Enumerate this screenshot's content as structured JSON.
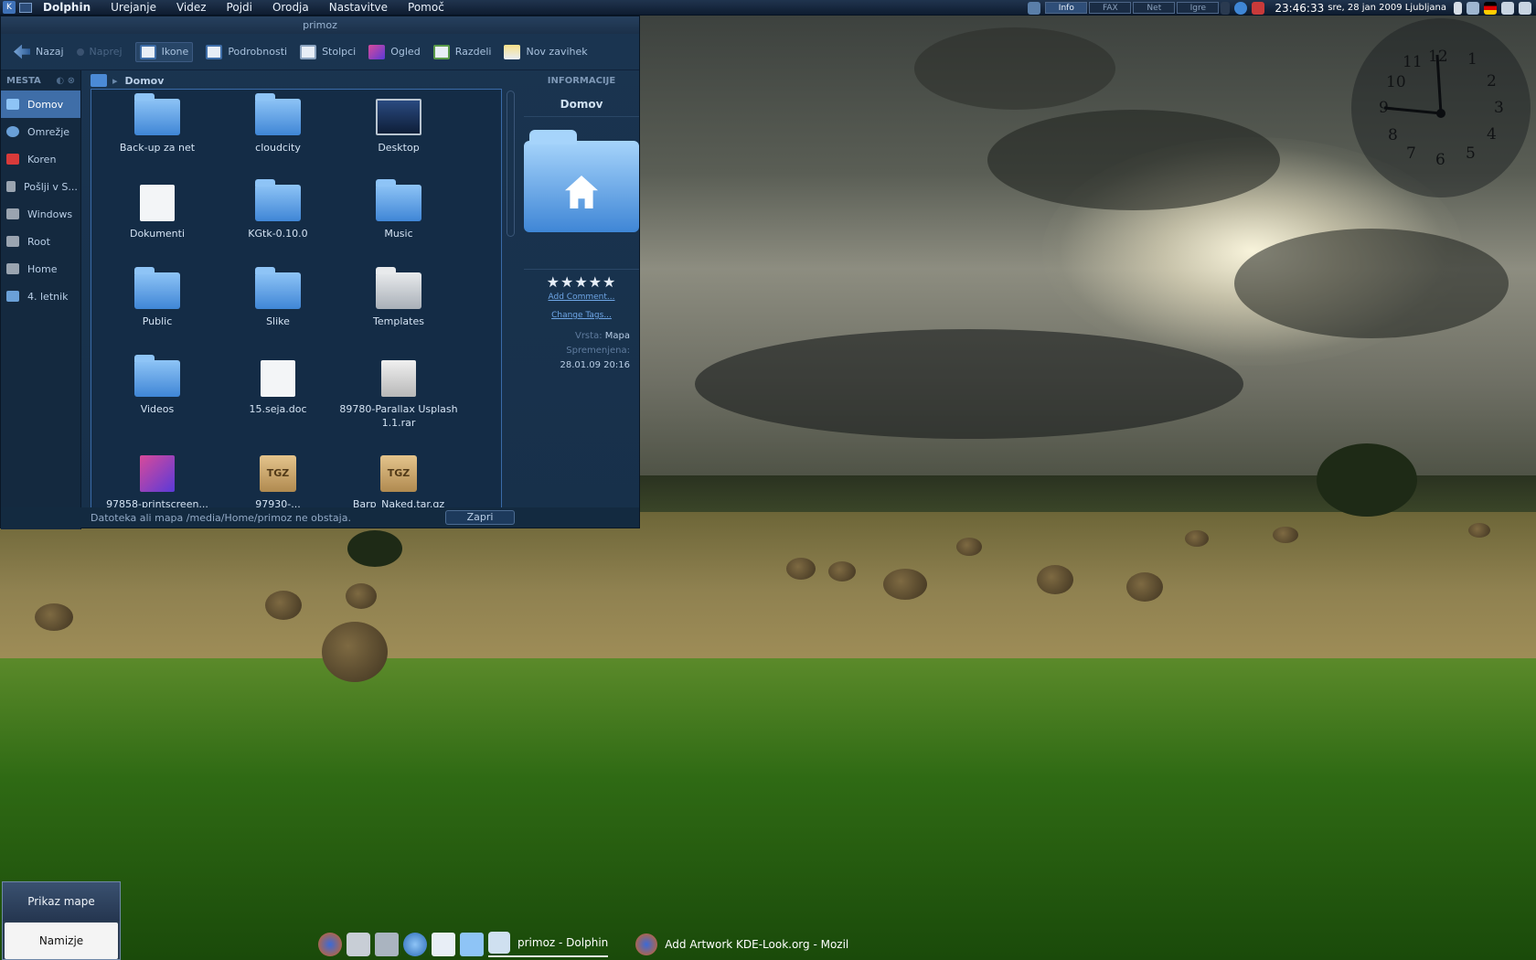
{
  "menubar": {
    "app": "Dolphin",
    "items": [
      "Urejanje",
      "Videz",
      "Pojdi",
      "Orodja",
      "Nastavitve",
      "Pomoč"
    ]
  },
  "tray": {
    "pager": [
      "Info",
      "FAX",
      "Net",
      "Igre"
    ],
    "time": "23:46:33",
    "date": "sre, 28 jan 2009 Ljubljana"
  },
  "clock_numbers": [
    "12",
    "1",
    "2",
    "3",
    "4",
    "5",
    "6",
    "7",
    "8",
    "9",
    "10",
    "11"
  ],
  "window": {
    "title": "primoz",
    "toolbar": [
      "Nazaj",
      "Naprej",
      "Ikone",
      "Podrobnosti",
      "Stolpci",
      "Ogled",
      "Razdeli",
      "Nov zavihek"
    ]
  },
  "places": {
    "header": "MESTA",
    "items": [
      "Domov",
      "Omrežje",
      "Koren",
      "Pošlji v S...",
      "Windows",
      "Root",
      "Home",
      "4. letnik"
    ]
  },
  "breadcrumb": "Domov",
  "files": [
    "Back-up za net",
    "cloudcity",
    "Desktop",
    "Dokumenti",
    "KGtk-0.10.0",
    "Music",
    "Public",
    "Slike",
    "Templates",
    "Videos",
    "15.seja.doc",
    "89780-Parallax Usplash 1.1.rar",
    "97858-printscreen...",
    "97930-...",
    "Barp_Naked.tar.gz"
  ],
  "tgz_label": "TGZ",
  "info": {
    "header": "INFORMACIJE",
    "title": "Domov",
    "stars": "★★★★★",
    "add_comment": "Add Comment...",
    "change_tags": "Change Tags...",
    "type_label": "Vrsta:",
    "type_value": "Mapa",
    "modified_label": "Spremenjena:",
    "modified_value": "28.01.09 20:16"
  },
  "status": {
    "message": "Datoteka ali mapa /media/Home/primoz ne obstaja.",
    "close": "Zapri"
  },
  "popup": {
    "a": "Prikaz mape",
    "b": "Namizje"
  },
  "taskbar": {
    "tasks": [
      "primoz - Dolphin",
      "Add Artwork KDE-Look.org - Mozil"
    ]
  }
}
